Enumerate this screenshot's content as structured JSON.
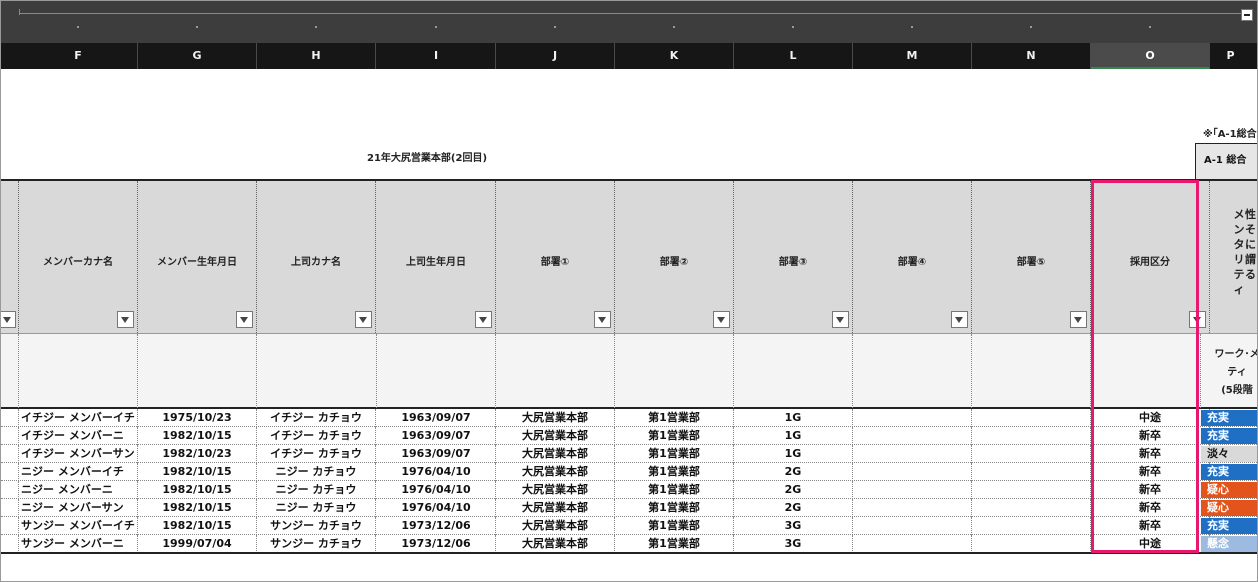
{
  "sheet": {
    "columns": [
      "F",
      "G",
      "H",
      "I",
      "J",
      "K",
      "L",
      "M",
      "N",
      "O",
      "P"
    ],
    "selected_column": "O",
    "title": "21年大尻営業本部(2回目)",
    "note_right": "※｢A-1総合",
    "box_right": "A-1 総合",
    "headers": [
      "メンバーカナ名",
      "メンバー生年月日",
      "上司カナ名",
      "上司生年月日",
      "部署①",
      "部署②",
      "部署③",
      "部署④",
      "部署⑤",
      "採用区分"
    ],
    "vertical_header_main": "メンタリティ",
    "vertical_header_side": "性そに謂る",
    "sub_header_p": [
      "ワーク･メ",
      "ティ",
      "(5段階"
    ],
    "rows": [
      [
        "イチジー メンバーイチ",
        "1975/10/23",
        "イチジー カチョウ",
        "1963/09/07",
        "大尻営業本部",
        "第1営業部",
        "1G",
        "",
        "",
        "中途",
        "充実"
      ],
      [
        "イチジー メンバーニ",
        "1982/10/15",
        "イチジー カチョウ",
        "1963/09/07",
        "大尻営業本部",
        "第1営業部",
        "1G",
        "",
        "",
        "新卒",
        "充実"
      ],
      [
        "イチジー メンバーサン",
        "1982/10/23",
        "イチジー カチョウ",
        "1963/09/07",
        "大尻営業本部",
        "第1営業部",
        "1G",
        "",
        "",
        "新卒",
        "淡々"
      ],
      [
        "ニジー メンバーイチ",
        "1982/10/15",
        "ニジー カチョウ",
        "1976/04/10",
        "大尻営業本部",
        "第1営業部",
        "2G",
        "",
        "",
        "新卒",
        "充実"
      ],
      [
        "ニジー メンバーニ",
        "1982/10/15",
        "ニジー カチョウ",
        "1976/04/10",
        "大尻営業本部",
        "第1営業部",
        "2G",
        "",
        "",
        "新卒",
        "疑心"
      ],
      [
        "ニジー メンバーサン",
        "1982/10/15",
        "ニジー カチョウ",
        "1976/04/10",
        "大尻営業本部",
        "第1営業部",
        "2G",
        "",
        "",
        "新卒",
        "疑心"
      ],
      [
        "サンジー メンバーイチ",
        "1982/10/15",
        "サンジー カチョウ",
        "1973/12/06",
        "大尻営業本部",
        "第1営業部",
        "3G",
        "",
        "",
        "新卒",
        "充実"
      ],
      [
        "サンジー メンバーニ",
        "1999/07/04",
        "サンジー カチョウ",
        "1973/12/06",
        "大尻営業本部",
        "第1営業部",
        "3G",
        "",
        "",
        "中途",
        "懸念"
      ]
    ],
    "p_colors": [
      "#1f6fc4",
      "#1f6fc4",
      "#d9d9d9",
      "#1f6fc4",
      "#e2541c",
      "#e2541c",
      "#1f6fc4",
      "#9dbbe0"
    ],
    "highlight_color": "#e8186e"
  }
}
